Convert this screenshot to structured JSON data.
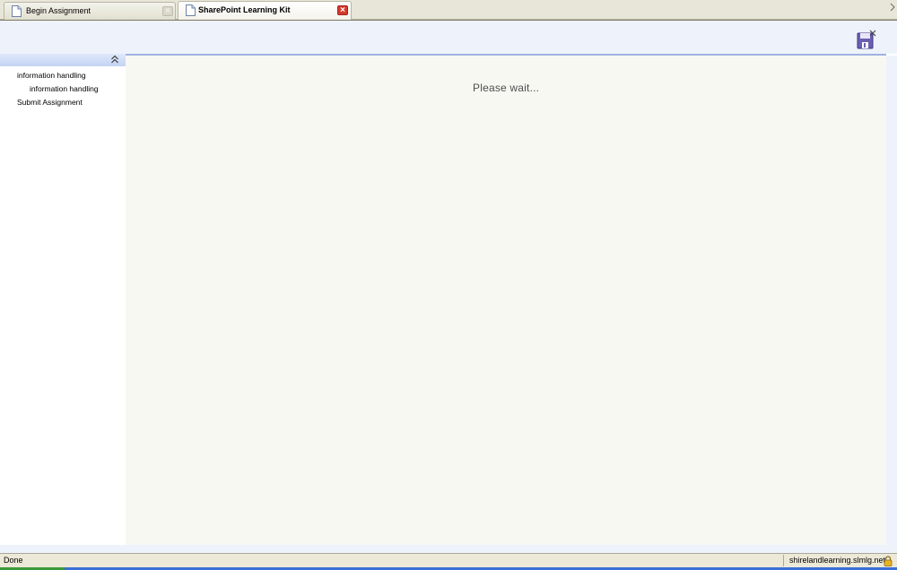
{
  "tabs": [
    {
      "label": "Begin Assignment",
      "active": false,
      "icon": "page-icon"
    },
    {
      "label": "SharePoint Learning Kit",
      "active": true,
      "icon": "page-icon"
    }
  ],
  "close_glyph": "×",
  "toolbar": {
    "save_icon": "save-icon"
  },
  "sidebar": {
    "collapse_icon": "double-chevron-up-icon",
    "items": [
      {
        "label": "information handling"
      },
      {
        "label": "information handling"
      },
      {
        "label": "Submit Assignment"
      }
    ]
  },
  "content": {
    "message": "Please wait..."
  },
  "statusbar": {
    "status": "Done",
    "host": "shirelandlearning.slmlg.net",
    "lock_icon": "padlock-icon"
  },
  "colors": {
    "accent": "#9fb3e0",
    "close_active": "#d23c2e",
    "content_bg": "#f8f8f3"
  }
}
